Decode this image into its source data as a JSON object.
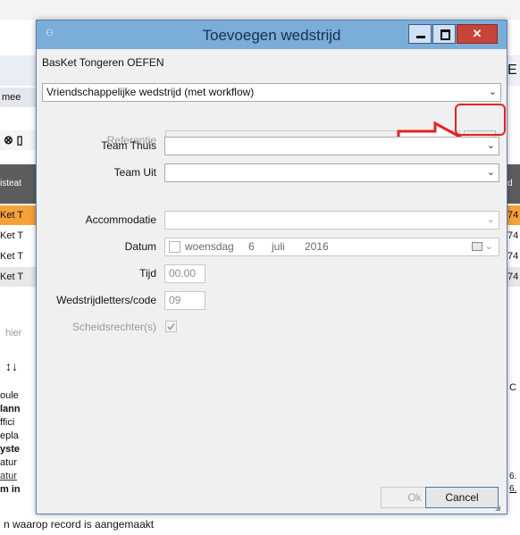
{
  "background": {
    "right_header": "E",
    "left_tab": "mee",
    "rows_left": [
      "isteat",
      "Ket T",
      "Ket T",
      "Ket T",
      "Ket T"
    ],
    "rows_right": [
      "d",
      "74",
      "74",
      "74",
      "74"
    ],
    "search_hint": "hier",
    "sort_glyph": "↕↓",
    "side_list": [
      "oule",
      "lann",
      "ffici",
      "epla",
      "yste",
      "atur",
      "atur",
      "m in"
    ],
    "side_right": [
      "C",
      "6.",
      "6."
    ],
    "status_line": "n waarop record is aangemaakt"
  },
  "dialog": {
    "title": "Toevoegen wedstrijd",
    "org": "BasKet Tongeren OEFEN",
    "match_type": "Vriendschappelijke wedstrijd (met workflow)",
    "labels": {
      "referentie": "Referentie",
      "team_thuis": "Team Thuis",
      "team_uit": "Team Uit",
      "accommodatie": "Accommodatie",
      "datum": "Datum",
      "tijd": "Tijd",
      "code": "Wedstrijdletters/code",
      "scheids": "Scheidsrechter(s)"
    },
    "date": {
      "day_name": "woensdag",
      "day": "6",
      "month": "juli",
      "year": "2016"
    },
    "time": "00.00",
    "code": "09",
    "browse_label": "...",
    "ok": "Ok",
    "cancel": "Cancel"
  },
  "colors": {
    "title_bar": "#7badd9",
    "arrow": "#e52222"
  }
}
